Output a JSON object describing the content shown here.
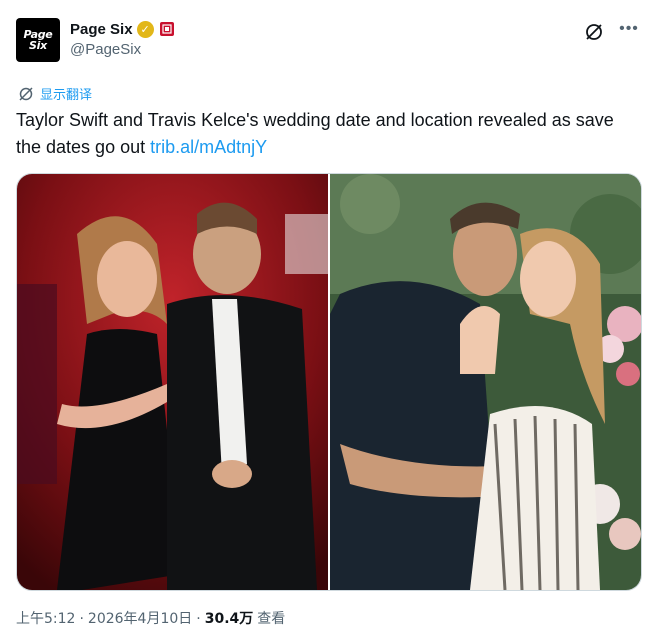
{
  "author": {
    "avatar_text_line1": "Page",
    "avatar_text_line2": "Six",
    "display_name": "Page Six",
    "handle": "@PageSix"
  },
  "translate": {
    "label": "显示翻译"
  },
  "tweet": {
    "text": "Taylor Swift and Travis Kelce's wedding date and location revealed as save the dates go out ",
    "link": "trib.al/mAdtnjY"
  },
  "meta": {
    "time": "上午5:12",
    "separator": "·",
    "date": "2026年4月10日",
    "views_count": "30.4万",
    "views_label": "查看"
  },
  "colors": {
    "link": "#1d9bf0",
    "verified_gold": "#e2b719",
    "muted": "#536471"
  },
  "icons": {
    "verified": "verified-badge-icon",
    "affiliate": "affiliate-badge-icon",
    "grok": "grok-icon",
    "more": "more-icon",
    "translate": "translate-icon"
  }
}
